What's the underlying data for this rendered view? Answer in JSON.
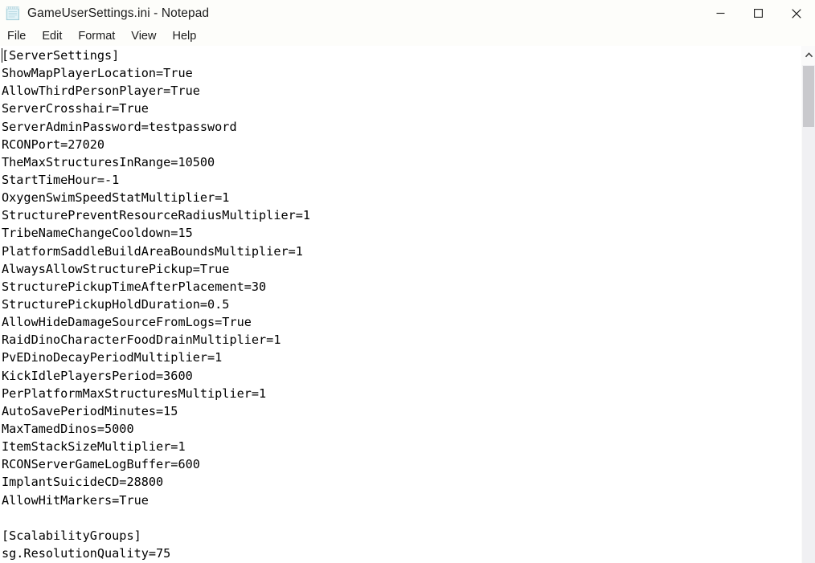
{
  "window": {
    "title": "GameUserSettings.ini - Notepad",
    "app_icon": "notepad-icon",
    "chrome_color": "#fdfdfa",
    "text_color": "#000000",
    "background_color": "#ffffff"
  },
  "window_controls": {
    "minimize_label": "Minimize",
    "maximize_label": "Maximize",
    "close_label": "Close"
  },
  "menubar": {
    "items": [
      {
        "label": "File"
      },
      {
        "label": "Edit"
      },
      {
        "label": "Format"
      },
      {
        "label": "View"
      },
      {
        "label": "Help"
      }
    ]
  },
  "editor": {
    "caret_line": 1,
    "caret_column": 1,
    "font": "monospace",
    "lines": [
      "[ServerSettings]",
      "ShowMapPlayerLocation=True",
      "AllowThirdPersonPlayer=True",
      "ServerCrosshair=True",
      "ServerAdminPassword=testpassword",
      "RCONPort=27020",
      "TheMaxStructuresInRange=10500",
      "StartTimeHour=-1",
      "OxygenSwimSpeedStatMultiplier=1",
      "StructurePreventResourceRadiusMultiplier=1",
      "TribeNameChangeCooldown=15",
      "PlatformSaddleBuildAreaBoundsMultiplier=1",
      "AlwaysAllowStructurePickup=True",
      "StructurePickupTimeAfterPlacement=30",
      "StructurePickupHoldDuration=0.5",
      "AllowHideDamageSourceFromLogs=True",
      "RaidDinoCharacterFoodDrainMultiplier=1",
      "PvEDinoDecayPeriodMultiplier=1",
      "KickIdlePlayersPeriod=3600",
      "PerPlatformMaxStructuresMultiplier=1",
      "AutoSavePeriodMinutes=15",
      "MaxTamedDinos=5000",
      "ItemStackSizeMultiplier=1",
      "RCONServerGameLogBuffer=600",
      "ImplantSuicideCD=28800",
      "AllowHitMarkers=True",
      "",
      "[ScalabilityGroups]",
      "sg.ResolutionQuality=75"
    ]
  },
  "scrollbar": {
    "orientation": "vertical",
    "up_arrow_icon": "chevron-up-icon",
    "thumb_color": "#c9c9cd",
    "track_color": "#f0f0f3"
  }
}
